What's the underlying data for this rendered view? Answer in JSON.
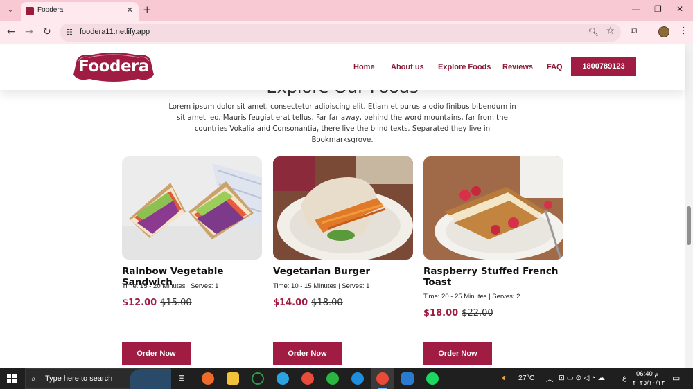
{
  "browser": {
    "tab_title": "Foodera",
    "url": "foodera11.netlify.app",
    "icons": [
      "tab-menu-icon",
      "close-icon",
      "plus-icon",
      "back-icon",
      "forward-icon",
      "reload-icon",
      "site-info-icon",
      "zoom-icon",
      "star-icon",
      "extensions-icon",
      "avatar",
      "more-icon"
    ]
  },
  "site": {
    "logo_text": "Foodera",
    "nav": [
      {
        "label": "Home"
      },
      {
        "label": "About us"
      },
      {
        "label": "Explore Foods"
      },
      {
        "label": "Reviews"
      },
      {
        "label": "FAQ"
      }
    ],
    "phone_button": "1800789123",
    "section_heading": "Explore Our Foods",
    "intro": "Lorem ipsum dolor sit amet, consectetur adipiscing elit. Etiam et purus a odio finibus bibendum in sit amet leo. Mauris feugiat erat tellus. Far far away, behind the word mountains, far from the countries Vokalia and Consonantia, there live the blind texts. Separated they live in Bookmarksgrove.",
    "colors": {
      "brand": "#a01c42",
      "nav": "#8b1a38"
    }
  },
  "foods": [
    {
      "title": "Rainbow Vegetable Sandwich",
      "meta": "Time: 15 - 20 Minutes | Serves: 1",
      "price": "$12.00",
      "old_price": "$15.00",
      "button": "Order Now"
    },
    {
      "title": "Vegetarian Burger",
      "meta": "Time: 10 - 15 Minutes | Serves: 1",
      "price": "$14.00",
      "old_price": "$18.00",
      "button": "Order Now"
    },
    {
      "title": "Raspberry Stuffed French Toast",
      "meta": "Time: 20 - 25 Minutes | Serves: 2",
      "price": "$18.00",
      "old_price": "$22.00",
      "button": "Order Now"
    }
  ],
  "taskbar": {
    "search_placeholder": "Type here to search",
    "temperature": "27°C",
    "time": "06:40 م",
    "date": "٢٠٢٥/١٠/١٣",
    "lang": "ع"
  }
}
